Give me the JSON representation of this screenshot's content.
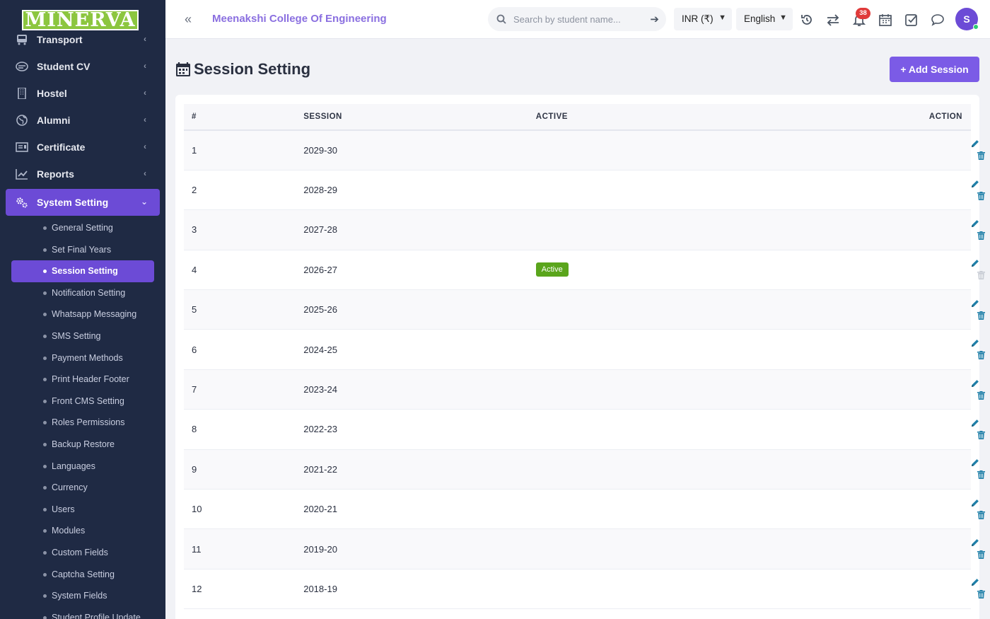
{
  "brand": {
    "logo_text": "MINERVA"
  },
  "sidebar": {
    "items": [
      {
        "label": "Transport",
        "icon": "bus-icon"
      },
      {
        "label": "Student CV",
        "icon": "cv-icon"
      },
      {
        "label": "Hostel",
        "icon": "building-icon"
      },
      {
        "label": "Alumni",
        "icon": "globe-icon"
      },
      {
        "label": "Certificate",
        "icon": "certificate-icon"
      },
      {
        "label": "Reports",
        "icon": "chart-line-icon"
      },
      {
        "label": "System Setting",
        "icon": "gears-icon"
      }
    ],
    "submenu": [
      "General Setting",
      "Set Final Years",
      "Session Setting",
      "Notification Setting",
      "Whatsapp Messaging",
      "SMS Setting",
      "Payment Methods",
      "Print Header Footer",
      "Front CMS Setting",
      "Roles Permissions",
      "Backup Restore",
      "Languages",
      "Currency",
      "Users",
      "Modules",
      "Custom Fields",
      "Captcha Setting",
      "System Fields",
      "Student Profile Update"
    ]
  },
  "topbar": {
    "college_name": "Meenakshi College Of Engineering",
    "search_placeholder": "Search by student name...",
    "currency": "INR (₹)",
    "language": "English",
    "notification_count": "38",
    "avatar_initial": "S"
  },
  "page": {
    "title": "Session Setting",
    "add_button": "+ Add Session"
  },
  "table": {
    "headers": {
      "num": "#",
      "session": "SESSION",
      "active": "ACTIVE",
      "action": "ACTION"
    },
    "rows": [
      {
        "num": "1",
        "session": "2029-30",
        "active": ""
      },
      {
        "num": "2",
        "session": "2028-29",
        "active": ""
      },
      {
        "num": "3",
        "session": "2027-28",
        "active": ""
      },
      {
        "num": "4",
        "session": "2026-27",
        "active": "Active"
      },
      {
        "num": "5",
        "session": "2025-26",
        "active": ""
      },
      {
        "num": "6",
        "session": "2024-25",
        "active": ""
      },
      {
        "num": "7",
        "session": "2023-24",
        "active": ""
      },
      {
        "num": "8",
        "session": "2022-23",
        "active": ""
      },
      {
        "num": "9",
        "session": "2021-22",
        "active": ""
      },
      {
        "num": "10",
        "session": "2020-21",
        "active": ""
      },
      {
        "num": "11",
        "session": "2019-20",
        "active": ""
      },
      {
        "num": "12",
        "session": "2018-19",
        "active": ""
      }
    ]
  },
  "colors": {
    "accent": "#6c4bd6",
    "sidebar_bg": "#1f2a44",
    "active_badge": "#5aa51c",
    "action_icon": "#1f7fa8",
    "notification_badge": "#e03a3a"
  }
}
